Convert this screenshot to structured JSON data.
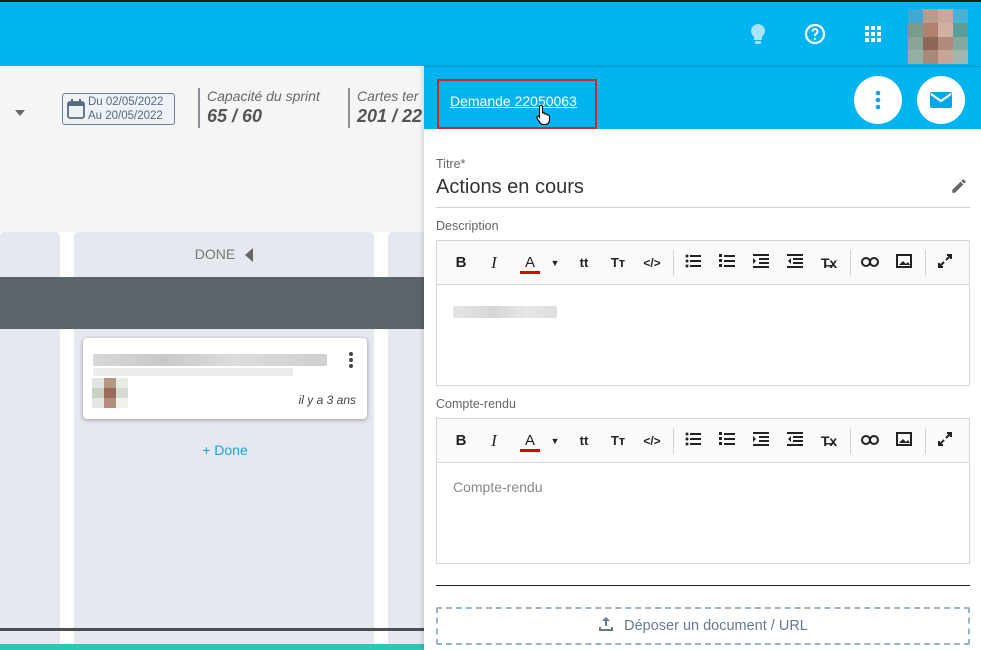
{
  "sprint": {
    "date_from": "Du 02/05/2022",
    "date_to": "Au 20/05/2022",
    "capacity_label": "Capacité du sprint",
    "capacity_value": "65 / 60",
    "cards_label": "Cartes ter",
    "cards_value": "201 / 22"
  },
  "board": {
    "column_title": "DONE",
    "card": {
      "age": "il y a 3 ans"
    },
    "add_label": "+ Done"
  },
  "panel": {
    "request_link": "Demande 22050063",
    "title_label": "Titre*",
    "title_value": "Actions en cours",
    "description_label": "Description",
    "report_label": "Compte-rendu",
    "report_placeholder": "Compte-rendu",
    "upload_label": "Déposer un document / URL"
  },
  "colors": {
    "brand": "#00b4f0",
    "link_highlight": "#d0262d",
    "add_link": "#1ba3e0",
    "board_column": "#e5e8ef"
  },
  "icons": [
    "lightbulb-icon",
    "help-icon",
    "apps-grid-icon",
    "calendar-icon",
    "more-vert-icon",
    "mail-icon",
    "pencil-icon",
    "upload-icon",
    "cursor-hand-icon"
  ]
}
